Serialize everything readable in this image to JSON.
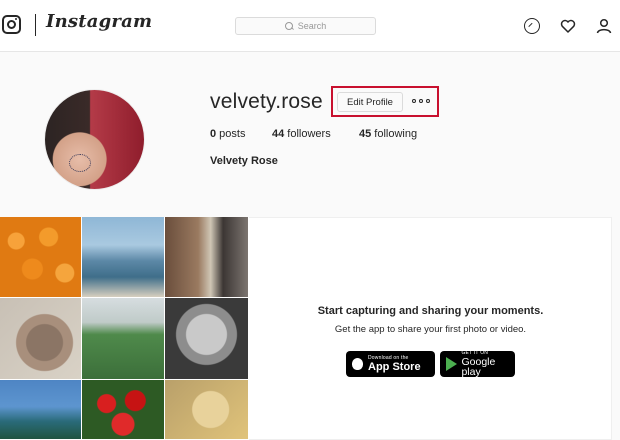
{
  "nav": {
    "brand": "Instagram",
    "search_placeholder": "Search",
    "icons": [
      "instagram-icon",
      "compass-icon",
      "heart-icon",
      "person-icon"
    ]
  },
  "profile": {
    "username": "velvety.rose",
    "edit_label": "Edit Profile",
    "posts_count": "0",
    "posts_label": " posts",
    "followers_count": "44",
    "followers_label": " followers",
    "following_count": "45",
    "following_label": " following",
    "full_name": "Velvety Rose"
  },
  "promo": {
    "title": "Start capturing and sharing your moments.",
    "subtitle": "Get the app to share your first photo or video.",
    "appstore_small": "Download on the",
    "appstore_big": "App Store",
    "googleplay_small": "GET IT ON",
    "googleplay_big": "Google play"
  },
  "colors": {
    "highlight": "#c8102e",
    "text": "#262626",
    "border": "#dbdbdb"
  }
}
